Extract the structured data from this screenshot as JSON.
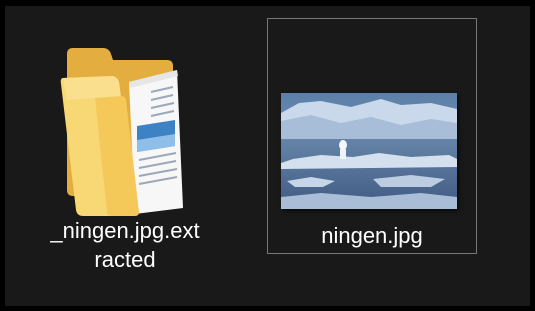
{
  "files": [
    {
      "name_line1": "_ningen.jpg.ext",
      "name_line2": "racted",
      "icon": "folder-icon",
      "type": "folder",
      "selected": false
    },
    {
      "name": "ningen.jpg",
      "icon": "image-thumbnail",
      "type": "jpg",
      "selected": true
    }
  ],
  "colors": {
    "background": "#191919",
    "selection_border": "#777777",
    "text": "#ffffff",
    "folder": "#F4C95A"
  }
}
